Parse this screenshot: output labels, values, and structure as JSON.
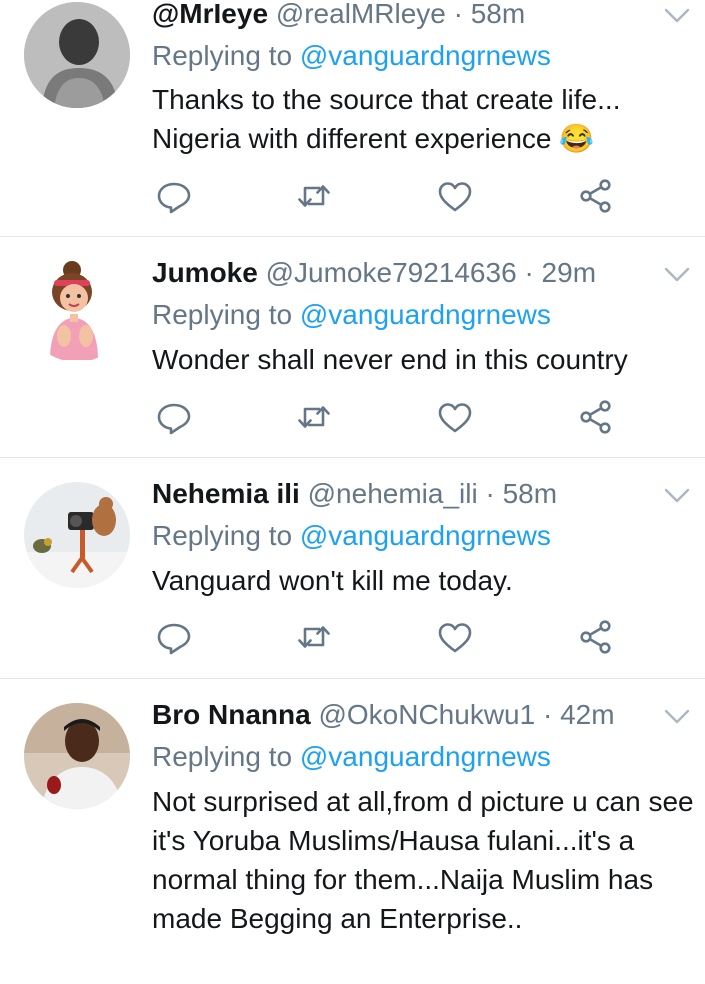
{
  "replying_label": "Replying to",
  "tweets": [
    {
      "name": "@MrIeye",
      "handle": "@realMRleye",
      "time": "58m",
      "mention": "@vanguardngrnews",
      "text": "Thanks to the source that create life... Nigeria with different experience 😂"
    },
    {
      "name": "Jumoke",
      "handle": "@Jumoke79214636",
      "time": "29m",
      "mention": "@vanguardngrnews",
      "text": "Wonder shall never end in this country"
    },
    {
      "name": "Nehemia ili",
      "handle": "@nehemia_ili",
      "time": "58m",
      "mention": "@vanguardngrnews",
      "text": "Vanguard won't kill me today."
    },
    {
      "name": "Bro Nnanna",
      "handle": "@OkoNChukwu1",
      "time": "42m",
      "mention": "@vanguardngrnews",
      "text": "Not surprised at all,from d picture u can see it's Yoruba Muslims/Hausa fulani...it's a normal thing for them...Naija Muslim has made Begging an Enterprise.."
    }
  ],
  "colors": {
    "text": "#14171a",
    "secondary": "#657786",
    "link": "#1da1f2",
    "divider": "#e1e8ed"
  },
  "icons": {
    "reply": "reply-icon",
    "retweet": "retweet-icon",
    "like": "heart-icon",
    "share": "share-icon",
    "menu": "chevron-down-icon"
  }
}
